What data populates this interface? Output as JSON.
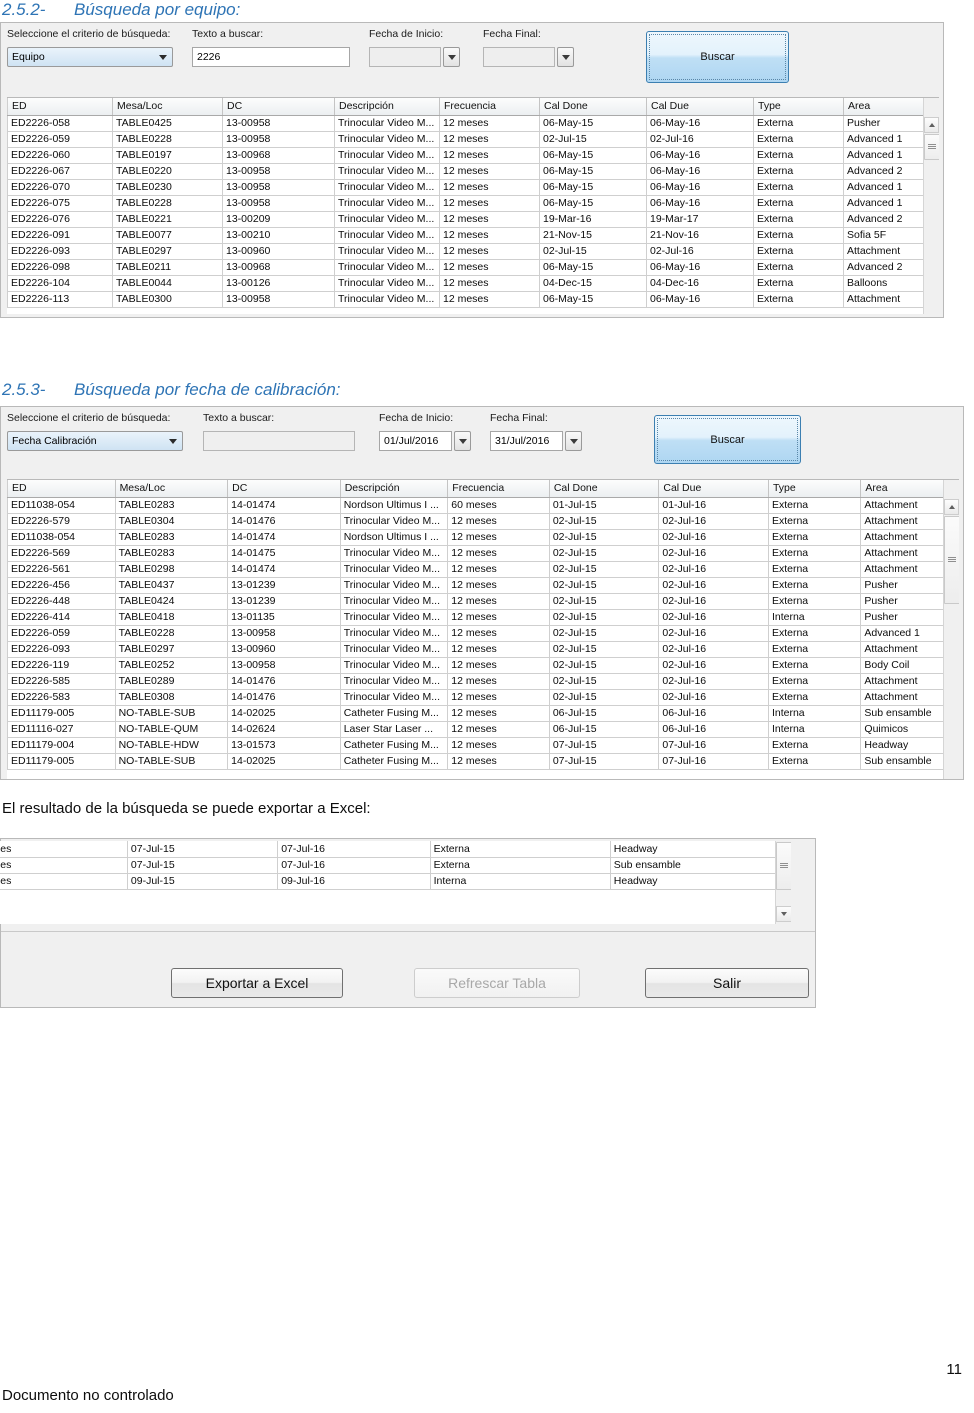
{
  "document": {
    "page_number": "11",
    "footer_note": "Documento no controlado"
  },
  "section_equipo": {
    "number": "2.5.2-",
    "title": "Búsqueda por equipo:",
    "form": {
      "criterio_label": "Seleccione el criterio de búsqueda:",
      "criterio_value": "Equipo",
      "texto_label": "Texto a buscar:",
      "texto_value": "2226",
      "fecha_inicio_label": "Fecha de Inicio:",
      "fecha_inicio_value": "",
      "fecha_final_label": "Fecha Final:",
      "fecha_final_value": "",
      "buscar_label": "Buscar"
    },
    "table": {
      "columns": [
        "ED",
        "Mesa/Loc",
        "DC",
        "Descripción",
        "Frecuencia",
        "Cal Done",
        "Cal Due",
        "Type",
        "Area"
      ],
      "rows": [
        [
          "ED2226-058",
          "TABLE0425",
          "13-00958",
          "Trinocular Video M...",
          "12 meses",
          "06-May-15",
          "06-May-16",
          "Externa",
          "Pusher"
        ],
        [
          "ED2226-059",
          "TABLE0228",
          "13-00958",
          "Trinocular Video M...",
          "12 meses",
          "02-Jul-15",
          "02-Jul-16",
          "Externa",
          "Advanced 1"
        ],
        [
          "ED2226-060",
          "TABLE0197",
          "13-00968",
          "Trinocular Video M...",
          "12 meses",
          "06-May-15",
          "06-May-16",
          "Externa",
          "Advanced 1"
        ],
        [
          "ED2226-067",
          "TABLE0220",
          "13-00958",
          "Trinocular Video M...",
          "12 meses",
          "06-May-15",
          "06-May-16",
          "Externa",
          "Advanced 2"
        ],
        [
          "ED2226-070",
          "TABLE0230",
          "13-00958",
          "Trinocular Video M...",
          "12 meses",
          "06-May-15",
          "06-May-16",
          "Externa",
          "Advanced 1"
        ],
        [
          "ED2226-075",
          "TABLE0228",
          "13-00958",
          "Trinocular Video M...",
          "12 meses",
          "06-May-15",
          "06-May-16",
          "Externa",
          "Advanced 1"
        ],
        [
          "ED2226-076",
          "TABLE0221",
          "13-00209",
          "Trinocular Video M...",
          "12 meses",
          "19-Mar-16",
          "19-Mar-17",
          "Externa",
          "Advanced 2"
        ],
        [
          "ED2226-091",
          "TABLE0077",
          "13-00210",
          "Trinocular Video M...",
          "12 meses",
          "21-Nov-15",
          "21-Nov-16",
          "Externa",
          "Sofia 5F"
        ],
        [
          "ED2226-093",
          "TABLE0297",
          "13-00960",
          "Trinocular Video M...",
          "12 meses",
          "02-Jul-15",
          "02-Jul-16",
          "Externa",
          "Attachment"
        ],
        [
          "ED2226-098",
          "TABLE0211",
          "13-00968",
          "Trinocular Video M...",
          "12 meses",
          "06-May-15",
          "06-May-16",
          "Externa",
          "Advanced 2"
        ],
        [
          "ED2226-104",
          "TABLE0044",
          "13-00126",
          "Trinocular Video M...",
          "12 meses",
          "04-Dec-15",
          "04-Dec-16",
          "Externa",
          "Balloons"
        ],
        [
          "ED2226-113",
          "TABLE0300",
          "13-00958",
          "Trinocular Video M...",
          "12 meses",
          "06-May-15",
          "06-May-16",
          "Externa",
          "Attachment"
        ]
      ]
    }
  },
  "section_fecha": {
    "number": "2.5.3-",
    "title": "Búsqueda por fecha de calibración:",
    "form": {
      "criterio_label": "Seleccione el criterio de búsqueda:",
      "criterio_value": "Fecha Calibración",
      "texto_label": "Texto a buscar:",
      "texto_value": "",
      "fecha_inicio_label": "Fecha de Inicio:",
      "fecha_inicio_value": "01/Jul/2016",
      "fecha_final_label": "Fecha Final:",
      "fecha_final_value": "31/Jul/2016",
      "buscar_label": "Buscar"
    },
    "table": {
      "columns": [
        "ED",
        "Mesa/Loc",
        "DC",
        "Descripción",
        "Frecuencia",
        "Cal Done",
        "Cal Due",
        "Type",
        "Area"
      ],
      "rows": [
        [
          "ED11038-054",
          "TABLE0283",
          "14-01474",
          "Nordson Ultimus I ...",
          "60 meses",
          "01-Jul-15",
          "01-Jul-16",
          "Externa",
          "Attachment"
        ],
        [
          "ED2226-579",
          "TABLE0304",
          "14-01476",
          "Trinocular Video M...",
          "12 meses",
          "02-Jul-15",
          "02-Jul-16",
          "Externa",
          "Attachment"
        ],
        [
          "ED11038-054",
          "TABLE0283",
          "14-01474",
          "Nordson Ultimus I ...",
          "12 meses",
          "02-Jul-15",
          "02-Jul-16",
          "Externa",
          "Attachment"
        ],
        [
          "ED2226-569",
          "TABLE0283",
          "14-01475",
          "Trinocular Video M...",
          "12 meses",
          "02-Jul-15",
          "02-Jul-16",
          "Externa",
          "Attachment"
        ],
        [
          "ED2226-561",
          "TABLE0298",
          "14-01474",
          "Trinocular Video M...",
          "12 meses",
          "02-Jul-15",
          "02-Jul-16",
          "Externa",
          "Attachment"
        ],
        [
          "ED2226-456",
          "TABLE0437",
          "13-01239",
          "Trinocular Video M...",
          "12 meses",
          "02-Jul-15",
          "02-Jul-16",
          "Externa",
          "Pusher"
        ],
        [
          "ED2226-448",
          "TABLE0424",
          "13-01239",
          "Trinocular Video M...",
          "12 meses",
          "02-Jul-15",
          "02-Jul-16",
          "Externa",
          "Pusher"
        ],
        [
          "ED2226-414",
          "TABLE0418",
          "13-01135",
          "Trinocular Video M...",
          "12 meses",
          "02-Jul-15",
          "02-Jul-16",
          "Interna",
          "Pusher"
        ],
        [
          "ED2226-059",
          "TABLE0228",
          "13-00958",
          "Trinocular Video M...",
          "12 meses",
          "02-Jul-15",
          "02-Jul-16",
          "Externa",
          "Advanced 1"
        ],
        [
          "ED2226-093",
          "TABLE0297",
          "13-00960",
          "Trinocular Video M...",
          "12 meses",
          "02-Jul-15",
          "02-Jul-16",
          "Externa",
          "Attachment"
        ],
        [
          "ED2226-119",
          "TABLE0252",
          "13-00958",
          "Trinocular Video M...",
          "12 meses",
          "02-Jul-15",
          "02-Jul-16",
          "Externa",
          "Body Coil"
        ],
        [
          "ED2226-585",
          "TABLE0289",
          "14-01476",
          "Trinocular Video M...",
          "12 meses",
          "02-Jul-15",
          "02-Jul-16",
          "Externa",
          "Attachment"
        ],
        [
          "ED2226-583",
          "TABLE0308",
          "14-01476",
          "Trinocular Video M...",
          "12 meses",
          "02-Jul-15",
          "02-Jul-16",
          "Externa",
          "Attachment"
        ],
        [
          "ED11179-005",
          "NO-TABLE-SUB",
          "14-02025",
          "Catheter Fusing M...",
          "12 meses",
          "06-Jul-15",
          "06-Jul-16",
          "Interna",
          "Sub ensamble"
        ],
        [
          "ED11116-027",
          "NO-TABLE-QUM",
          "14-02624",
          "Laser Star Laser ...",
          "12 meses",
          "06-Jul-15",
          "06-Jul-16",
          "Interna",
          "Quimicos"
        ],
        [
          "ED11179-004",
          "NO-TABLE-HDW",
          "13-01573",
          "Catheter Fusing M...",
          "12 meses",
          "07-Jul-15",
          "07-Jul-16",
          "Externa",
          "Headway"
        ],
        [
          "ED11179-005",
          "NO-TABLE-SUB",
          "14-02025",
          "Catheter Fusing M...",
          "12 meses",
          "07-Jul-15",
          "07-Jul-16",
          "Externa",
          "Sub ensamble"
        ]
      ]
    }
  },
  "export_section": {
    "caption": "El resultado de la búsqueda se puede exportar a Excel:",
    "table": {
      "rows": [
        [
          "ses",
          "07-Jul-15",
          "07-Jul-16",
          "Externa",
          "Headway"
        ],
        [
          "ses",
          "07-Jul-15",
          "07-Jul-16",
          "Externa",
          "Sub ensamble"
        ],
        [
          "ses",
          "09-Jul-15",
          "09-Jul-16",
          "Interna",
          "Headway"
        ]
      ]
    },
    "buttons": {
      "export_label": "Exportar a Excel",
      "refresh_label": "Refrescar Tabla",
      "exit_label": "Salir"
    }
  }
}
